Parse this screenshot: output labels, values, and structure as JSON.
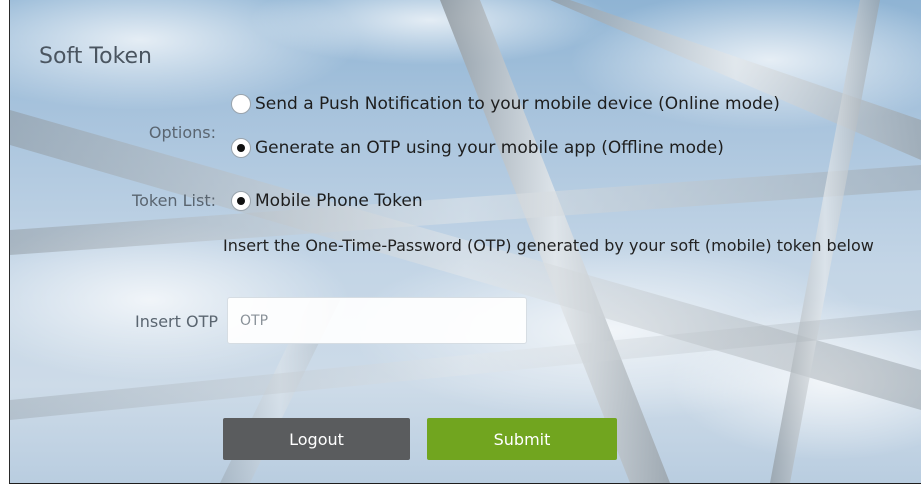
{
  "title": "Soft Token",
  "options": {
    "label": "Options:",
    "push": "Send a Push Notification to your mobile device (Online mode)",
    "otp": "Generate an OTP using your mobile app (Offline mode)",
    "selected": "otp"
  },
  "token_list": {
    "label": "Token List:",
    "item": "Mobile Phone Token"
  },
  "info_text": "Insert the One-Time-Password (OTP) generated by your soft (mobile) token below",
  "otp_field": {
    "label": "Insert OTP",
    "placeholder": "OTP",
    "value": ""
  },
  "buttons": {
    "logout": "Logout",
    "submit": "Submit"
  },
  "colors": {
    "logout_button": "#5a5c5e",
    "submit_button": "#71a51f"
  }
}
